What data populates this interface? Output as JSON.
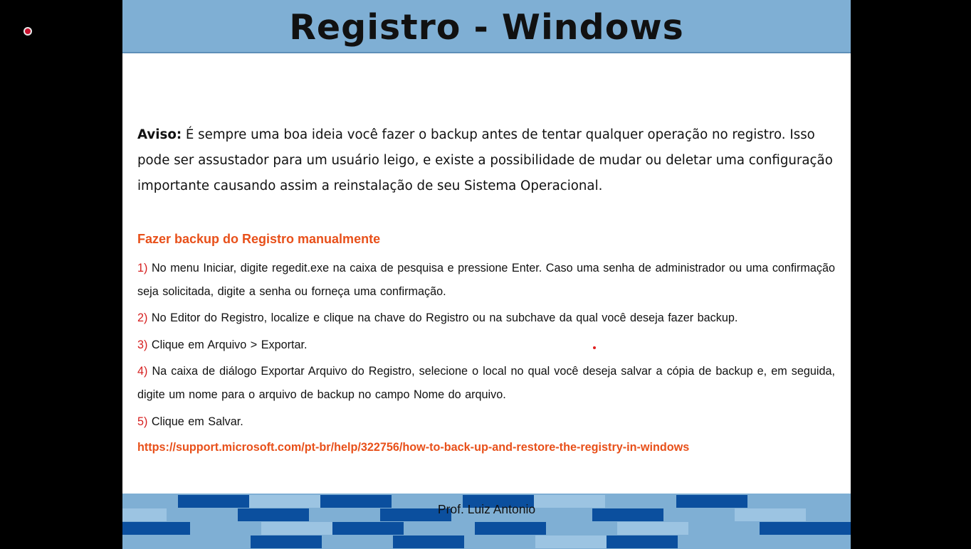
{
  "title": "Registro - Windows",
  "aviso": {
    "label": "Aviso:",
    "text": " É sempre uma boa ideia você fazer o backup antes de tentar qualquer operação no registro. Isso pode ser assustador para um usuário leigo, e existe a possibilidade de mudar ou deletar uma configuração importante causando assim a reinstalação de seu Sistema Operacional."
  },
  "section_heading": "Fazer backup do Registro manualmente",
  "steps": [
    {
      "num": "1)",
      "text": " No menu Iniciar, digite regedit.exe  na caixa de pesquisa e pressione Enter. Caso uma senha de administrador  ou uma confirmação  seja solicitada, digite a senha ou forneça uma confirmação."
    },
    {
      "num": "2)",
      "text": " No Editor do Registro, localize e clique na chave do Registro ou na subchave  da qual você deseja fazer backup."
    },
    {
      "num": "3)",
      "text": " Clique em Arquivo > Exportar."
    },
    {
      "num": "4)",
      "text": " Na caixa de diálogo Exportar Arquivo do Registro, selecione o local no qual você deseja salvar a cópia de backup e, em seguida, digite um nome para o arquivo de backup no campo  Nome do arquivo."
    },
    {
      "num": "5)",
      "text": " Clique em Salvar."
    }
  ],
  "link": "https://support.microsoft.com/pt-br/help/322756/how-to-back-up-and-restore-the-registry-in-windows",
  "footer": {
    "author": "Prof. Luiz Antonio"
  },
  "colors": {
    "title_bar": "#7fafd4",
    "heading_orange": "#e8501a",
    "number_red": "#d61f1f",
    "brick_dark": "#0b4f9e",
    "brick_light": "#9cc4e2"
  }
}
